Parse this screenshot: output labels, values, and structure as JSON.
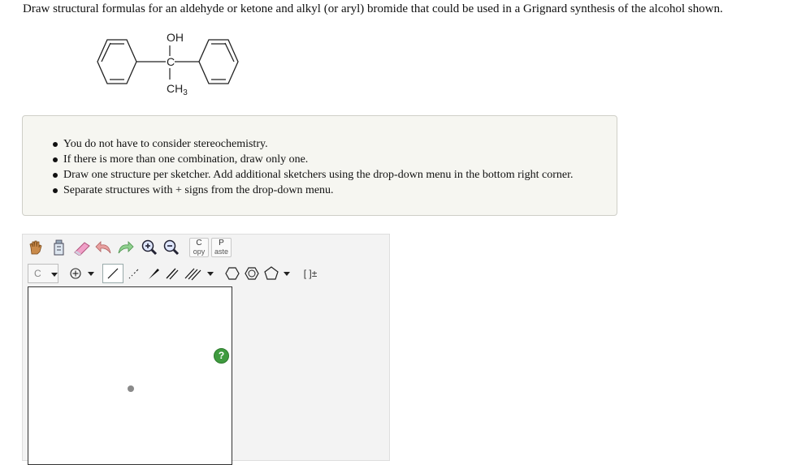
{
  "question": "Draw structural formulas for an aldehyde or ketone and alkyl (or aryl) bromide that could be used in a Grignard synthesis of the alcohol shown.",
  "molecule": {
    "top_group": "OH",
    "center_atom": "C",
    "bottom_group": "CH",
    "bottom_subscript": "3"
  },
  "instructions": [
    "You do not have to consider stereochemistry.",
    "If there is more than one combination, draw only one.",
    "Draw one structure per sketcher. Add additional sketchers using the drop-down menu in the bottom right corner.",
    "Separate structures with + signs from the drop-down menu."
  ],
  "sketcher": {
    "copy": {
      "big": "C",
      "small": "opy"
    },
    "paste": {
      "big": "P",
      "small": "aste"
    },
    "element": "C",
    "bracket": "[ ]±",
    "help": "?"
  }
}
